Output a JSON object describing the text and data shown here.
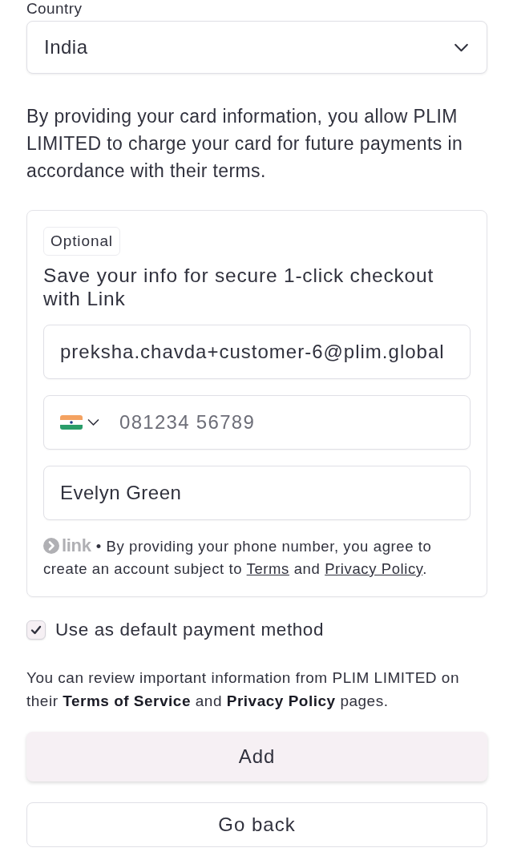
{
  "country": {
    "label": "Country",
    "value": "India"
  },
  "authorization_text": "By providing your card information, you allow PLIM LIMITED to charge your card for future payments in accordance with their terms.",
  "link_signup": {
    "badge": "Optional",
    "title": "Save your info for secure 1-click checkout with Link",
    "fields": [
      {
        "kind": "email",
        "value": "preksha.chavda+customer-6@plim.global"
      },
      {
        "kind": "phone",
        "placeholder": "081234 56789"
      },
      {
        "kind": "name",
        "value": "Evelyn Green"
      }
    ],
    "logo_text": "link",
    "separator": "•",
    "legal": [
      {
        "kind": "text",
        "text": "By providing your phone number, you agree to create an account subject to "
      },
      {
        "kind": "link",
        "text": "Terms"
      },
      {
        "kind": "text",
        "text": " and "
      },
      {
        "kind": "link",
        "text": "Privacy Policy"
      },
      {
        "kind": "text",
        "text": "."
      }
    ]
  },
  "default_payment": {
    "label": "Use as default payment method",
    "checked": true
  },
  "review_text": "You can review important information from PLIM LIMITED on their **Terms of Service** and **Privacy Policy** pages.",
  "buttons": [
    {
      "kind": "primary",
      "label": "Add"
    },
    {
      "kind": "secondary",
      "label": "Go back"
    }
  ]
}
